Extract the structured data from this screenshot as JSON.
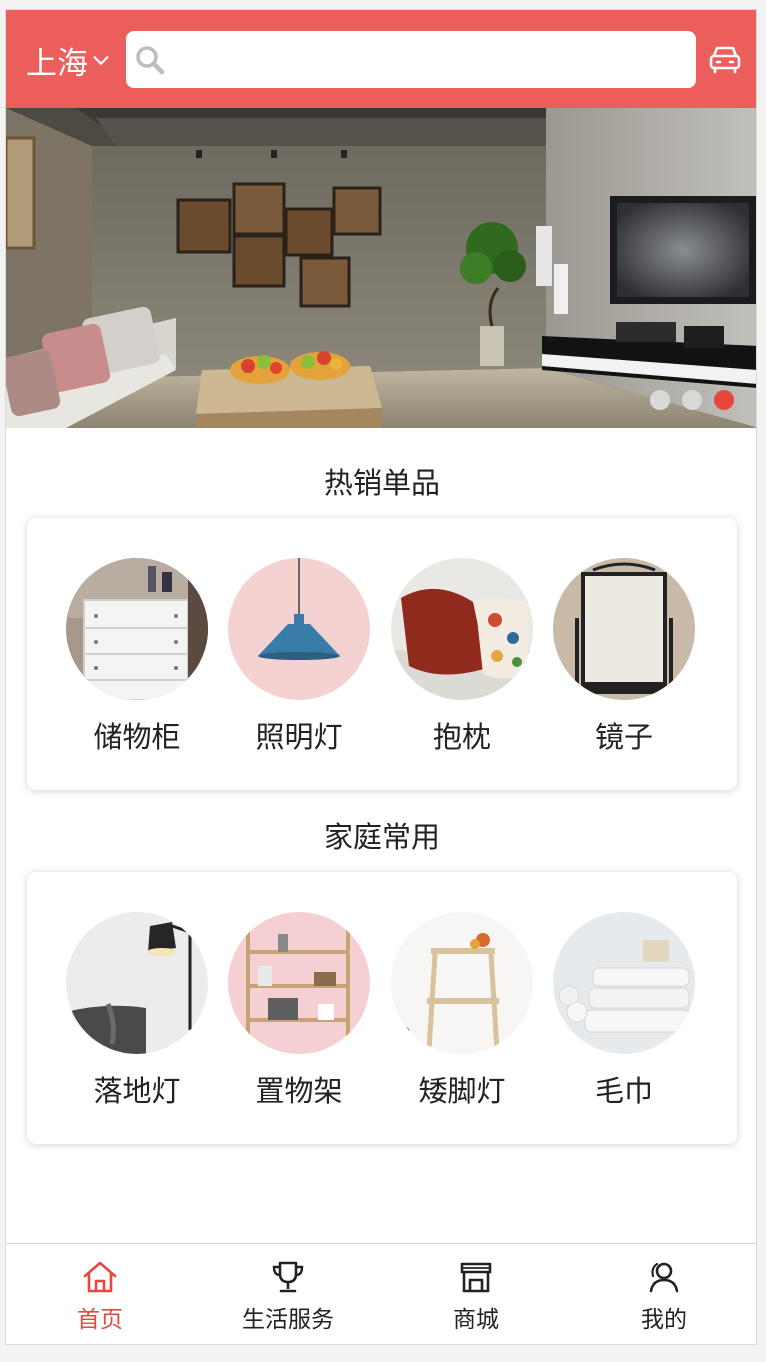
{
  "header": {
    "city": "上海",
    "search_placeholder": "",
    "icons": [
      "chevron-down-icon",
      "search-icon",
      "car-icon"
    ]
  },
  "banner": {
    "slide_count": 3,
    "active_slide": 3
  },
  "sections": [
    {
      "title": "热销单品",
      "items": [
        {
          "label": "储物柜"
        },
        {
          "label": "照明灯"
        },
        {
          "label": "抱枕"
        },
        {
          "label": "镜子"
        }
      ]
    },
    {
      "title": "家庭常用",
      "items": [
        {
          "label": "落地灯"
        },
        {
          "label": "置物架"
        },
        {
          "label": "矮脚灯"
        },
        {
          "label": "毛巾"
        }
      ]
    }
  ],
  "tabbar": {
    "tabs": [
      {
        "label": "首页",
        "icon": "home-icon",
        "active": true
      },
      {
        "label": "生活服务",
        "icon": "trophy-icon",
        "active": false
      },
      {
        "label": "商城",
        "icon": "store-icon",
        "active": false
      },
      {
        "label": "我的",
        "icon": "user-icon",
        "active": false
      }
    ]
  },
  "colors": {
    "accent": "#ec5e5c",
    "active_tab": "#e8473f",
    "text": "#222222"
  }
}
